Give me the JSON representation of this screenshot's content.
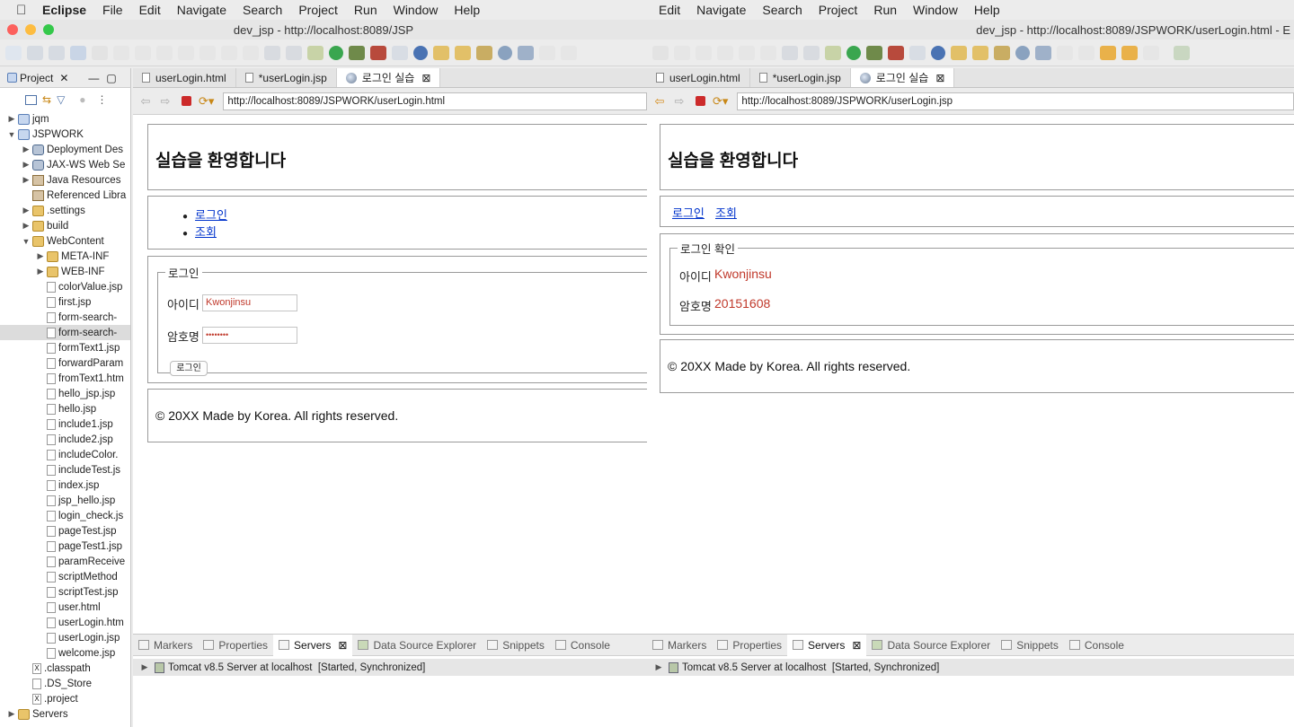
{
  "menubar": {
    "app": "Eclipse",
    "left_items": [
      "File",
      "Edit",
      "Navigate",
      "Search",
      "Project",
      "Run",
      "Window",
      "Help"
    ],
    "right_items": [
      "Edit",
      "Navigate",
      "Search",
      "Project",
      "Run",
      "Window",
      "Help"
    ]
  },
  "windows": {
    "left_title": "dev_jsp - http://localhost:8089/JSP",
    "right_title": "dev_jsp - http://localhost:8089/JSPWORK/userLogin.html - E"
  },
  "project_explorer": {
    "tab_label": "Project",
    "tree": [
      {
        "label": "jqm",
        "level": 0,
        "twisty": "▶",
        "icon": "proj"
      },
      {
        "label": "JSPWORK",
        "level": 0,
        "twisty": "▼",
        "icon": "proj"
      },
      {
        "label": "Deployment Des",
        "level": 1,
        "twisty": "▶",
        "icon": "gear"
      },
      {
        "label": "JAX-WS Web Se",
        "level": 1,
        "twisty": "▶",
        "icon": "gear"
      },
      {
        "label": "Java Resources",
        "level": 1,
        "twisty": "▶",
        "icon": "lib"
      },
      {
        "label": "Referenced Libra",
        "level": 1,
        "twisty": "",
        "icon": "lib"
      },
      {
        "label": ".settings",
        "level": 1,
        "twisty": "▶",
        "icon": "folder"
      },
      {
        "label": "build",
        "level": 1,
        "twisty": "▶",
        "icon": "folder"
      },
      {
        "label": "WebContent",
        "level": 1,
        "twisty": "▼",
        "icon": "folder"
      },
      {
        "label": "META-INF",
        "level": 2,
        "twisty": "▶",
        "icon": "folder"
      },
      {
        "label": "WEB-INF",
        "level": 2,
        "twisty": "▶",
        "icon": "folder"
      },
      {
        "label": "colorValue.jsp",
        "level": 2,
        "twisty": "",
        "icon": "file"
      },
      {
        "label": "first.jsp",
        "level": 2,
        "twisty": "",
        "icon": "file"
      },
      {
        "label": "form-search-",
        "level": 2,
        "twisty": "",
        "icon": "file"
      },
      {
        "label": "form-search-",
        "level": 2,
        "twisty": "",
        "icon": "file",
        "selected": true
      },
      {
        "label": "formText1.jsp",
        "level": 2,
        "twisty": "",
        "icon": "file"
      },
      {
        "label": "forwardParam",
        "level": 2,
        "twisty": "",
        "icon": "file"
      },
      {
        "label": "fromText1.htm",
        "level": 2,
        "twisty": "",
        "icon": "file"
      },
      {
        "label": "hello_jsp.jsp",
        "level": 2,
        "twisty": "",
        "icon": "file"
      },
      {
        "label": "hello.jsp",
        "level": 2,
        "twisty": "",
        "icon": "file"
      },
      {
        "label": "include1.jsp",
        "level": 2,
        "twisty": "",
        "icon": "file"
      },
      {
        "label": "include2.jsp",
        "level": 2,
        "twisty": "",
        "icon": "file"
      },
      {
        "label": "includeColor.",
        "level": 2,
        "twisty": "",
        "icon": "file"
      },
      {
        "label": "includeTest.js",
        "level": 2,
        "twisty": "",
        "icon": "file"
      },
      {
        "label": "index.jsp",
        "level": 2,
        "twisty": "",
        "icon": "file"
      },
      {
        "label": "jsp_hello.jsp",
        "level": 2,
        "twisty": "",
        "icon": "file"
      },
      {
        "label": "login_check.js",
        "level": 2,
        "twisty": "",
        "icon": "file"
      },
      {
        "label": "pageTest.jsp",
        "level": 2,
        "twisty": "",
        "icon": "file"
      },
      {
        "label": "pageTest1.jsp",
        "level": 2,
        "twisty": "",
        "icon": "file"
      },
      {
        "label": "paramReceive",
        "level": 2,
        "twisty": "",
        "icon": "file"
      },
      {
        "label": "scriptMethod",
        "level": 2,
        "twisty": "",
        "icon": "file"
      },
      {
        "label": "scriptTest.jsp",
        "level": 2,
        "twisty": "",
        "icon": "file"
      },
      {
        "label": "user.html",
        "level": 2,
        "twisty": "",
        "icon": "file"
      },
      {
        "label": "userLogin.htm",
        "level": 2,
        "twisty": "",
        "icon": "file"
      },
      {
        "label": "userLogin.jsp",
        "level": 2,
        "twisty": "",
        "icon": "file"
      },
      {
        "label": "welcome.jsp",
        "level": 2,
        "twisty": "",
        "icon": "file"
      },
      {
        "label": ".classpath",
        "level": 1,
        "twisty": "",
        "icon": "x"
      },
      {
        "label": ".DS_Store",
        "level": 1,
        "twisty": "",
        "icon": "file"
      },
      {
        "label": ".project",
        "level": 1,
        "twisty": "",
        "icon": "x"
      },
      {
        "label": "Servers",
        "level": 0,
        "twisty": "▶",
        "icon": "folder"
      }
    ]
  },
  "left_editor": {
    "tabs": [
      "userLogin.html",
      "*userLogin.jsp",
      "로그인 실습"
    ],
    "url": "http://localhost:8089/JSPWORK/userLogin.html",
    "page": {
      "heading": "실습을 환영합니다",
      "nav_links": [
        "로그인",
        "조회"
      ],
      "legend": "로그인",
      "id_label": "아이디",
      "id_value": "Kwonjinsu",
      "pw_label": "암호명",
      "pw_value": "••••••••",
      "submit": "로그인",
      "footer": "© 20XX Made by Korea. All rights reserved."
    }
  },
  "right_editor": {
    "tabs": [
      "userLogin.html",
      "*userLogin.jsp",
      "로그인 실습"
    ],
    "url": "http://localhost:8089/JSPWORK/userLogin.jsp",
    "page": {
      "heading": "실습을 환영합니다",
      "nav_links": [
        "로그인",
        "조회"
      ],
      "legend": "로그인 확인",
      "id_label": "아이디",
      "id_value": "Kwonjinsu",
      "pw_label": "암호명",
      "pw_value": "20151608",
      "footer": "© 20XX Made by Korea. All rights reserved."
    }
  },
  "bottom_panel": {
    "tabs": [
      "Markers",
      "Properties",
      "Servers",
      "Data Source Explorer",
      "Snippets",
      "Console"
    ],
    "active_tab": "Servers",
    "server_row": "Tomcat v8.5 Server at localhost  [Started, Synchronized]"
  },
  "colors": {
    "value_red": "#c0392b",
    "link_blue": "#0033cc"
  }
}
